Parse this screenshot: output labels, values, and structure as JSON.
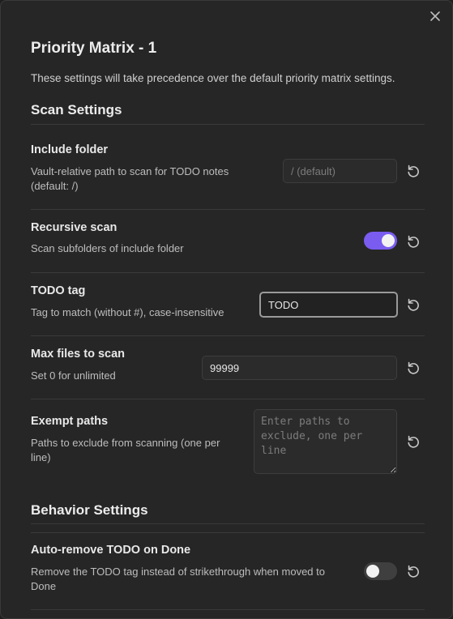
{
  "modal": {
    "title": "Priority Matrix - 1",
    "description": "These settings will take precedence over the default priority matrix settings."
  },
  "sections": {
    "scan": "Scan Settings",
    "behavior": "Behavior Settings"
  },
  "settings": {
    "include_folder": {
      "name": "Include folder",
      "desc_line1": "Vault-relative path to scan for TODO notes",
      "desc_line2": "(default: /)",
      "placeholder": "/ (default)",
      "value": ""
    },
    "recursive_scan": {
      "name": "Recursive scan",
      "desc": "Scan subfolders of include folder",
      "enabled": true
    },
    "todo_tag": {
      "name": "TODO tag",
      "desc": "Tag to match (without #), case-insensitive",
      "value": "TODO"
    },
    "max_files": {
      "name": "Max files to scan",
      "desc": "Set 0 for unlimited",
      "value": "99999"
    },
    "exempt_paths": {
      "name": "Exempt paths",
      "desc_line1": "Paths to exclude from scanning (one per",
      "desc_line2": "line)",
      "placeholder": "Enter paths to exclude, one per line"
    },
    "auto_remove": {
      "name": "Auto-remove TODO on Done",
      "desc_line1": "Remove the TODO tag instead of strikethrough when moved to",
      "desc_line2": "Done",
      "enabled": false
    }
  },
  "colors": {
    "accent": "#7a5cf0",
    "toggle_off": "#3f3f3f"
  },
  "icons": {
    "close": "close-icon",
    "reset": "reset-icon"
  }
}
